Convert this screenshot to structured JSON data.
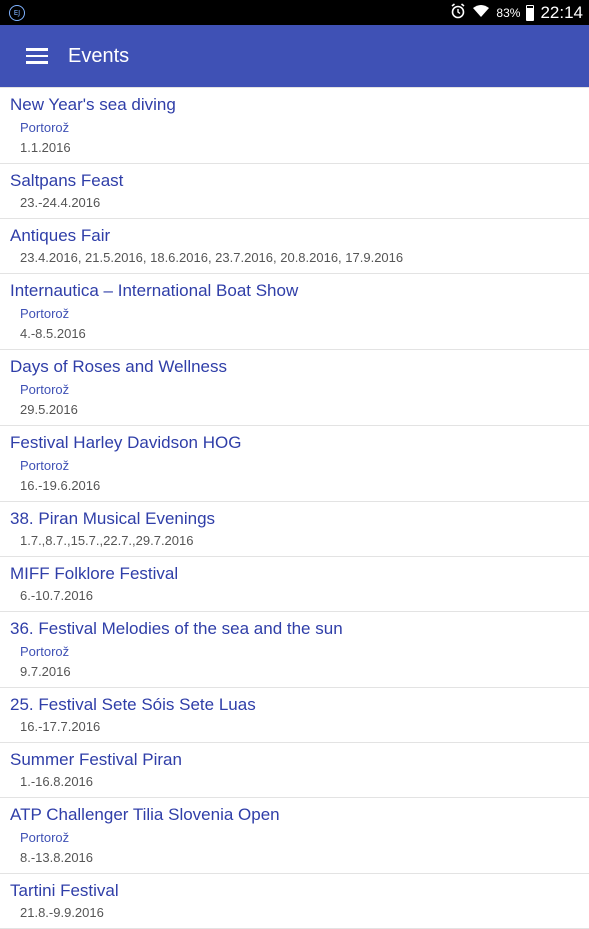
{
  "status": {
    "app_icon_text": "EJ",
    "battery_percent": "83%",
    "battery_level": 0.83,
    "time": "22:14"
  },
  "toolbar": {
    "title": "Events"
  },
  "events": [
    {
      "title": "New Year's sea diving",
      "place": "Portorož",
      "date": "1.1.2016"
    },
    {
      "title": "Saltpans Feast",
      "place": "",
      "date": "23.-24.4.2016"
    },
    {
      "title": "Antiques Fair",
      "place": "",
      "date": "23.4.2016, 21.5.2016, 18.6.2016, 23.7.2016, 20.8.2016, 17.9.2016"
    },
    {
      "title": "Internautica – International Boat Show",
      "place": "Portorož",
      "date": "4.-8.5.2016"
    },
    {
      "title": "Days of Roses and Wellness",
      "place": "Portorož",
      "date": "29.5.2016"
    },
    {
      "title": "Festival Harley Davidson HOG",
      "place": "Portorož",
      "date": "16.-19.6.2016"
    },
    {
      "title": "38. Piran Musical Evenings",
      "place": "",
      "date": "1.7.,8.7.,15.7.,22.7.,29.7.2016"
    },
    {
      "title": "MIFF Folklore Festival",
      "place": "",
      "date": "6.-10.7.2016"
    },
    {
      "title": "36. Festival Melodies of the sea and the sun",
      "place": "Portorož",
      "date": "9.7.2016"
    },
    {
      "title": "25. Festival Sete Sóis Sete Luas",
      "place": "",
      "date": "16.-17.7.2016"
    },
    {
      "title": "Summer Festival Piran",
      "place": "",
      "date": "1.-16.8.2016"
    },
    {
      "title": "ATP Challenger Tilia Slovenia Open",
      "place": "Portorož",
      "date": "8.-13.8.2016"
    },
    {
      "title": "Tartini Festival",
      "place": "",
      "date": "21.8.-9.9.2016"
    }
  ]
}
